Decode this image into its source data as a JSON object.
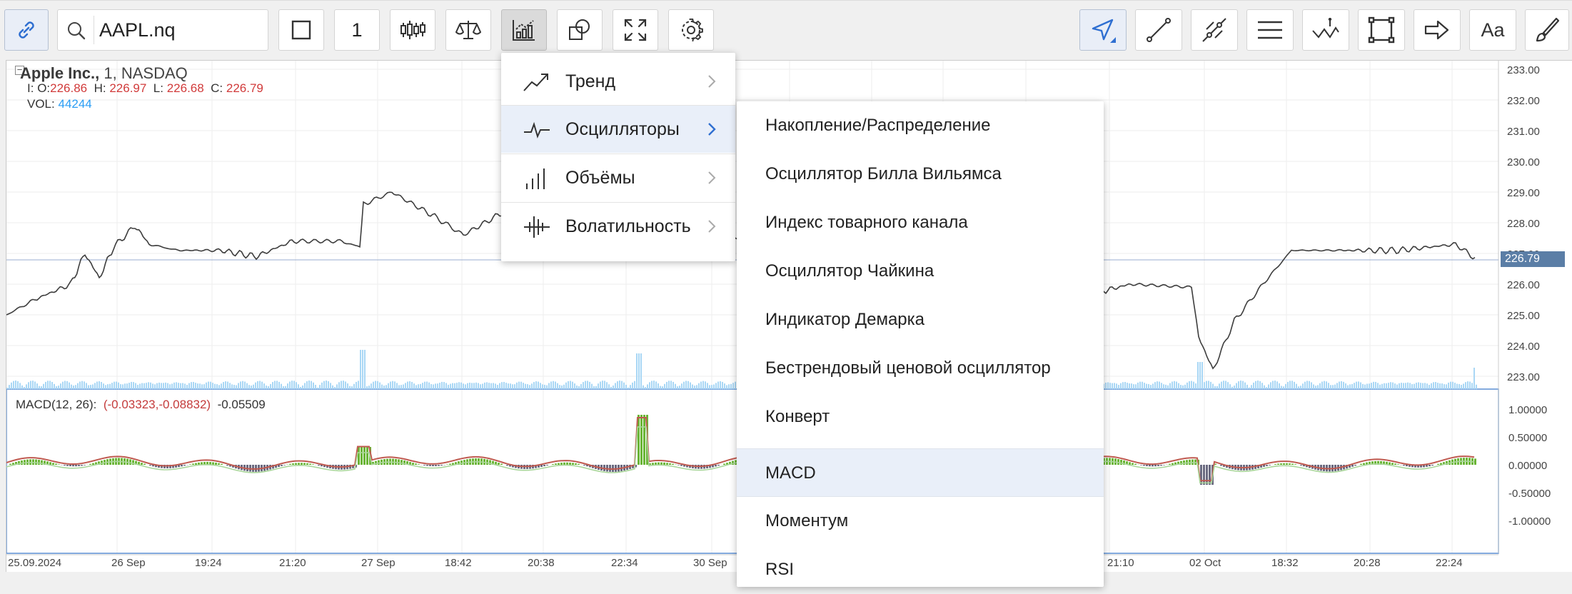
{
  "toolbar": {
    "symbol_value": "AAPL.nq",
    "interval_value": "1",
    "font_button_label": "Aa"
  },
  "legend": {
    "company": "Apple Inc.,",
    "interval": "1,",
    "exchange": "NASDAQ",
    "prefix": "I:",
    "o_label": "O:",
    "o_value": "226.86",
    "h_label": "H:",
    "h_value": "226.97",
    "l_label": "L:",
    "l_value": "226.68",
    "c_label": "C:",
    "c_value": "226.79",
    "vol_label": "VOL:",
    "vol_value": "44244",
    "collapse_glyph": "−"
  },
  "macd_legend": {
    "name": "MACD(12, 26):",
    "pair": "(-0.03323,-0.08832)",
    "hist": "-0.05509"
  },
  "current_price": "226.79",
  "price_axis": [
    "233.00",
    "232.00",
    "231.00",
    "230.00",
    "229.00",
    "228.00",
    "227.00",
    "226.00",
    "225.00",
    "224.00",
    "223.00"
  ],
  "macd_axis": [
    "1.00000",
    "0.50000",
    "0.00000",
    "-0.50000",
    "-1.00000"
  ],
  "time_axis": [
    "25.09.2024",
    "26 Sep",
    "19:24",
    "21:20",
    "27 Sep",
    "18:42",
    "20:38",
    "22:34",
    "30 Sep",
    "21:10",
    "02 Oct",
    "18:32",
    "20:28",
    "22:24"
  ],
  "indicator_menu": {
    "categories": [
      {
        "label": "Тренд",
        "icon": "trend-icon"
      },
      {
        "label": "Осцилляторы",
        "icon": "oscillator-icon",
        "selected": true
      },
      {
        "label": "Объёмы",
        "icon": "volume-icon"
      },
      {
        "label": "Волатильность",
        "icon": "volatility-icon"
      }
    ]
  },
  "oscillator_submenu": {
    "items": [
      {
        "label": "Накопление/Распределение"
      },
      {
        "label": "Осциллятор Билла Вильямса"
      },
      {
        "label": "Индекс товарного канала"
      },
      {
        "label": "Осциллятор Чайкина"
      },
      {
        "label": "Индикатор Демарка"
      },
      {
        "label": "Бестрендовый ценовой осциллятор"
      },
      {
        "label": "Конверт"
      },
      {
        "label": "MACD",
        "selected": true
      },
      {
        "label": "Моментум"
      },
      {
        "label": "RSI"
      }
    ]
  },
  "colors": {
    "accent": "#2f6fd1",
    "price_up": "#5fa832",
    "price_down": "#c0463c",
    "macd_histogram": "#6ab536",
    "volume": "#a9d7f5",
    "current_price_tag": "#5b7ea6"
  }
}
